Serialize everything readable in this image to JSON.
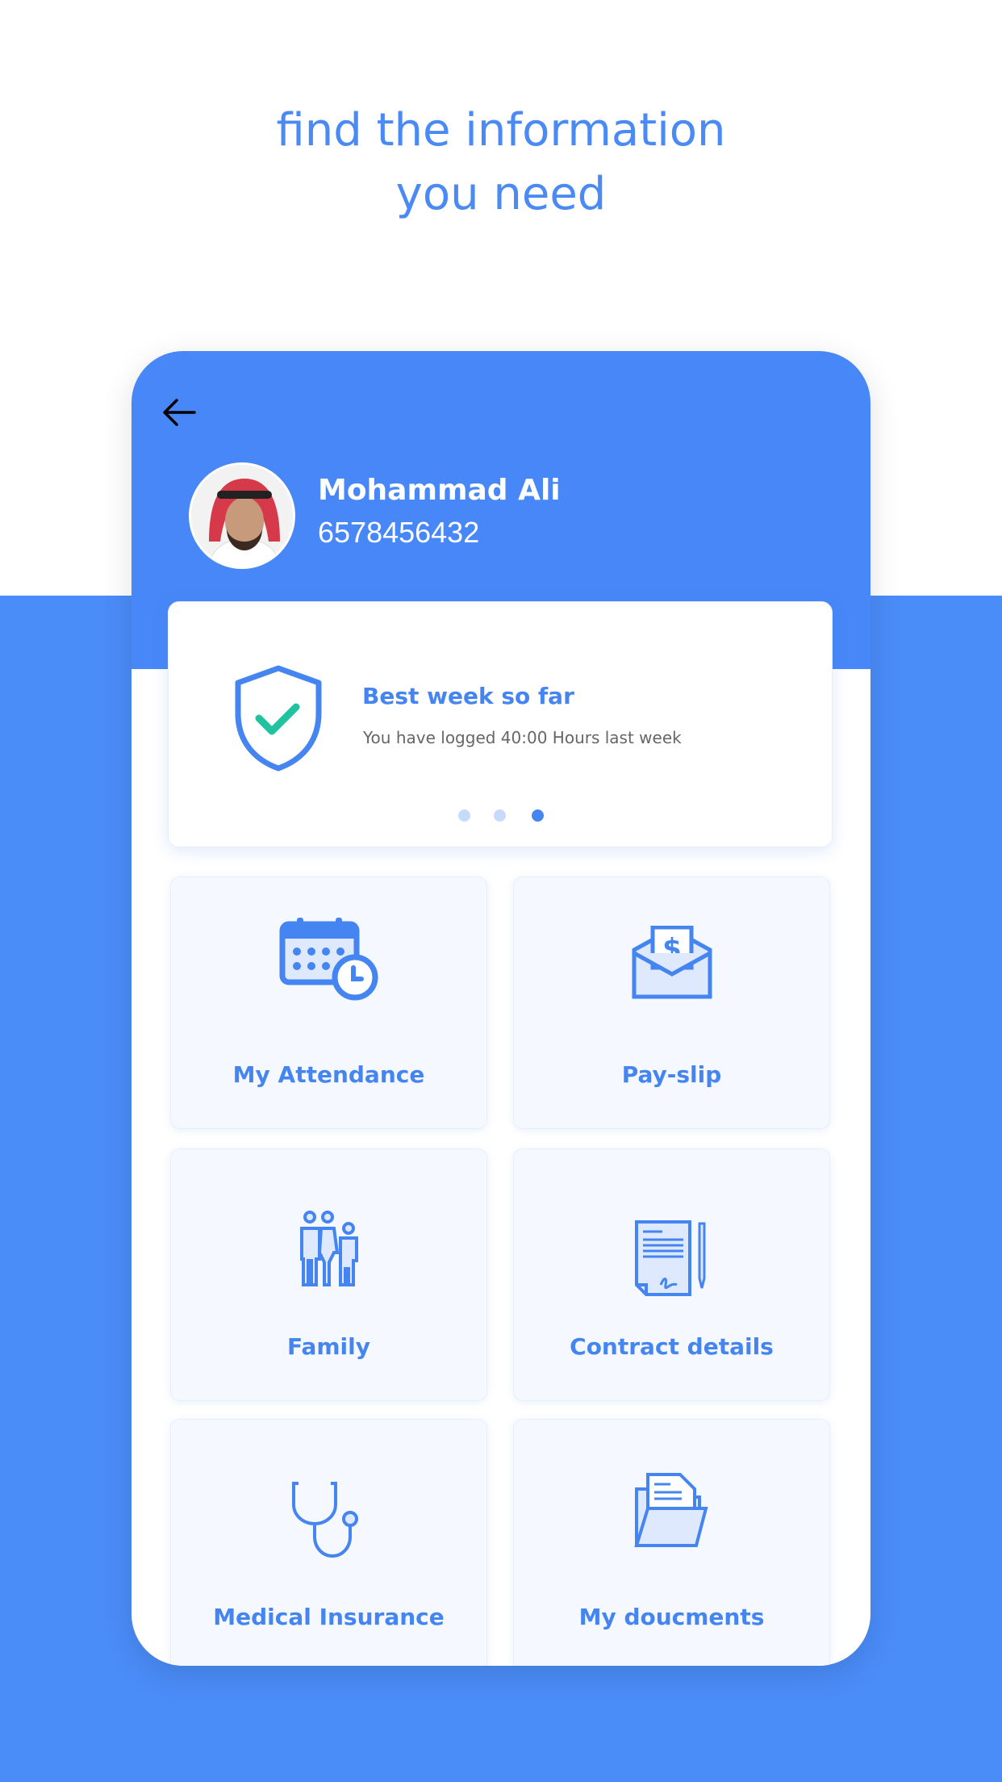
{
  "headline": {
    "line1": "find the information",
    "line2": "you need"
  },
  "profile": {
    "name": "Mohammad Ali",
    "id_number": "6578456432"
  },
  "highlight_card": {
    "title": "Best week so far",
    "subtitle": "You have logged 40:00 Hours last week",
    "carousel": {
      "total": 3,
      "active": 3
    }
  },
  "menu": [
    {
      "label": "My Attendance",
      "icon": "calendar-clock-icon"
    },
    {
      "label": "Pay-slip",
      "icon": "payslip-envelope-icon"
    },
    {
      "label": "Family",
      "icon": "family-icon"
    },
    {
      "label": "Contract details",
      "icon": "contract-icon"
    },
    {
      "label": "Medical Insurance",
      "icon": "stethoscope-icon"
    },
    {
      "label": "My doucments",
      "icon": "documents-folder-icon"
    }
  ],
  "colors": {
    "primary": "#4787f7",
    "accent_check": "#20c3a0",
    "background_blue": "#4a8cf8"
  }
}
